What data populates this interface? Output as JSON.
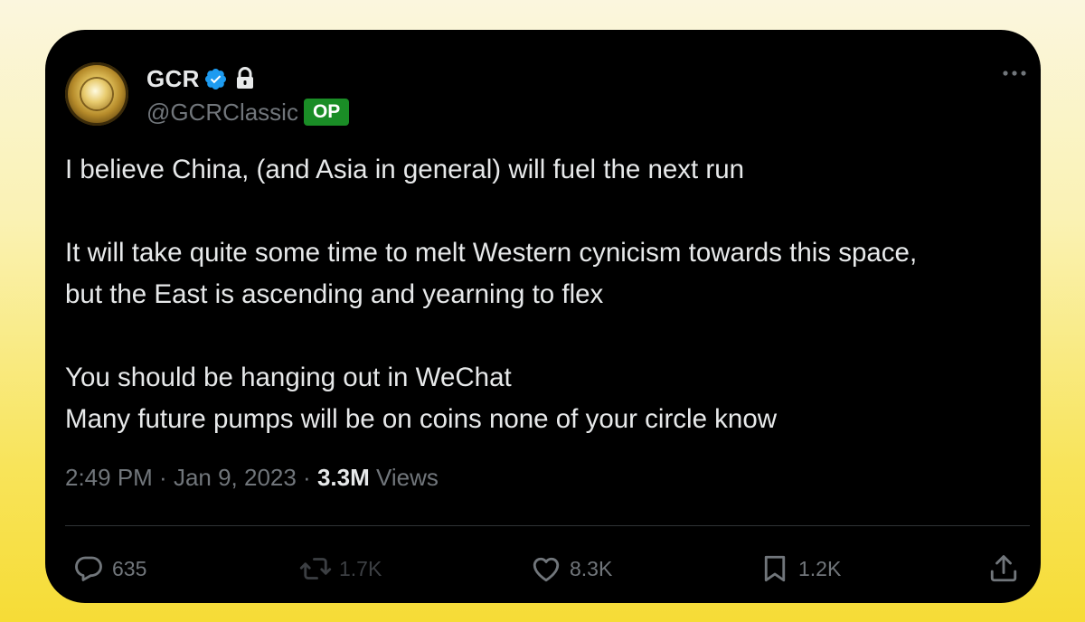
{
  "author": {
    "display_name": "GCR",
    "handle": "@GCRClassic",
    "badge": "OP",
    "verified_icon": "verified-badge-icon",
    "lock_icon": "lock-icon"
  },
  "tweet": {
    "text": "I believe China, (and Asia in general) will fuel the next run\n\nIt will take quite some time to melt Western cynicism towards this space,\nbut the East is ascending and yearning to flex\n\nYou should be hanging out in WeChat\nMany future pumps will be on coins none of your circle know",
    "time": "2:49 PM",
    "date": "Jan 9, 2023",
    "separator": " · ",
    "views_count": "3.3M",
    "views_label": " Views"
  },
  "actions": {
    "reply": {
      "icon": "reply-icon",
      "count": "635"
    },
    "repost": {
      "icon": "repost-icon",
      "count": "1.7K"
    },
    "like": {
      "icon": "heart-icon",
      "count": "8.3K"
    },
    "bookmark": {
      "icon": "bookmark-icon",
      "count": "1.2K"
    },
    "share": {
      "icon": "share-icon"
    }
  },
  "colors": {
    "background_top": "#fbf6de",
    "background_bottom": "#f6dc36",
    "card": "#000000",
    "text": "#e7e9ea",
    "muted": "#71767b",
    "verified": "#1d9bf0",
    "op_badge": "#1a8d26"
  }
}
